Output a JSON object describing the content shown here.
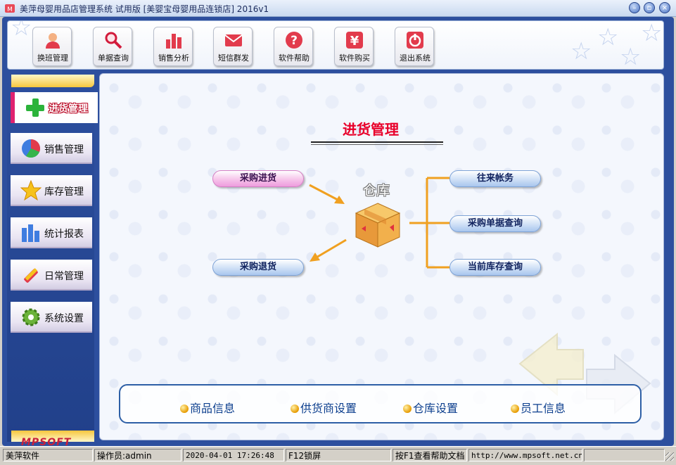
{
  "window": {
    "title": "美萍母婴用品店管理系统 试用版 [美婴宝母婴用品连锁店]  2016v1"
  },
  "toolbar": {
    "buttons": [
      {
        "label": "换班管理",
        "icon": "user-switch-icon"
      },
      {
        "label": "单据查询",
        "icon": "magnifier-icon"
      },
      {
        "label": "销售分析",
        "icon": "bar-chart-icon"
      },
      {
        "label": "短信群发",
        "icon": "envelope-icon"
      },
      {
        "label": "软件帮助",
        "icon": "help-icon"
      },
      {
        "label": "软件购买",
        "icon": "yen-icon"
      },
      {
        "label": "退出系统",
        "icon": "power-icon"
      }
    ]
  },
  "sidebar": {
    "items": [
      {
        "label": "进货管理",
        "icon": "plus-icon",
        "active": true
      },
      {
        "label": "销售管理",
        "icon": "pie-icon"
      },
      {
        "label": "库存管理",
        "icon": "star-icon"
      },
      {
        "label": "统计报表",
        "icon": "report-icon"
      },
      {
        "label": "日常管理",
        "icon": "tools-icon"
      },
      {
        "label": "系统设置",
        "icon": "gear-icon"
      }
    ]
  },
  "brand": {
    "logo": "MPSOFT"
  },
  "main": {
    "heading": "进货管理",
    "center_label": "仓库",
    "left_actions": [
      "采购进货",
      "采购退货"
    ],
    "right_actions": [
      "往来帐务",
      "采购单据查询",
      "当前库存查询"
    ],
    "bottom_links": [
      "商品信息",
      "供货商设置",
      "仓库设置",
      "员工信息"
    ]
  },
  "status": {
    "company": "美萍软件",
    "operator": "操作员:admin",
    "datetime": "2020-04-01 17:26:48",
    "lock_hint": "F12锁屏",
    "help_hint": "按F1查看帮助文档",
    "url": "http://www.mpsoft.net.cn"
  },
  "colors": {
    "frame": "#2d4f9e",
    "heading": "#e8002a",
    "accent_arrow": "#f0a020",
    "active_marker": "#e0226f"
  }
}
